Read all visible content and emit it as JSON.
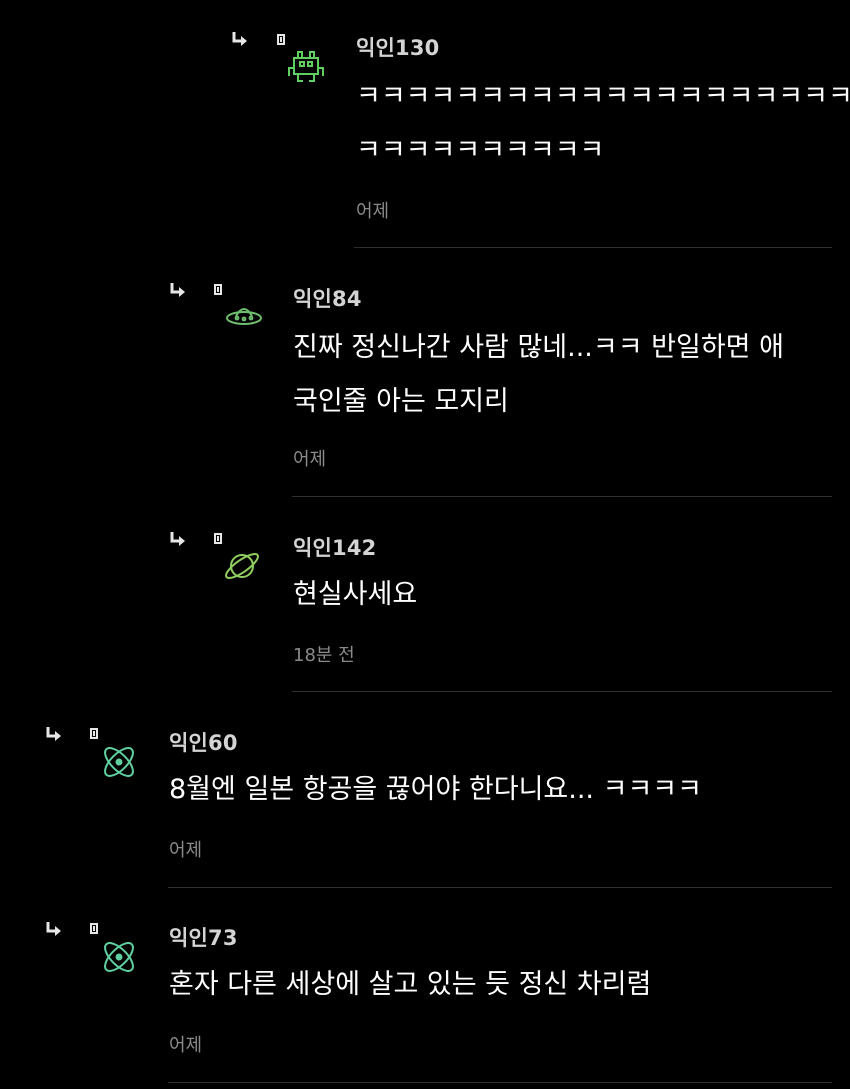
{
  "comments": [
    {
      "avatar_icon": "space-invader-icon",
      "avatar_color": "#5fcf5f",
      "nickname": "익인130",
      "lines": [
        "ㅋㅋㅋㅋㅋㅋㅋㅋㅋㅋㅋㅋㅋㅋㅋㅋㅋㅋㅋㅋ",
        "ㅋㅋㅋㅋㅋㅋㅋㅋㅋㅋ"
      ],
      "time": "어제"
    },
    {
      "avatar_icon": "ufo-icon",
      "avatar_color": "#6fbf6f",
      "nickname": "익인84",
      "lines": [
        "진짜 정신나간 사람 많네...ㅋㅋ 반일하면 애",
        "국인줄 아는 모지리"
      ],
      "time": "어제"
    },
    {
      "avatar_icon": "planet-icon",
      "avatar_color": "#8fcf5f",
      "nickname": "익인142",
      "lines": [
        "현실사세요"
      ],
      "time": "18분 전"
    },
    {
      "avatar_icon": "atom-icon",
      "avatar_color": "#5fcfa0",
      "nickname": "익인60",
      "lines": [
        "8월엔 일본 항공을 끊어야 한다니요... ㅋㅋㅋㅋ"
      ],
      "time": "어제"
    },
    {
      "avatar_icon": "atom-icon",
      "avatar_color": "#5fcfa0",
      "nickname": "익인73",
      "lines": [
        "혼자 다른 세상에 살고 있는 듯 정신 차리렴"
      ],
      "time": "어제"
    }
  ]
}
